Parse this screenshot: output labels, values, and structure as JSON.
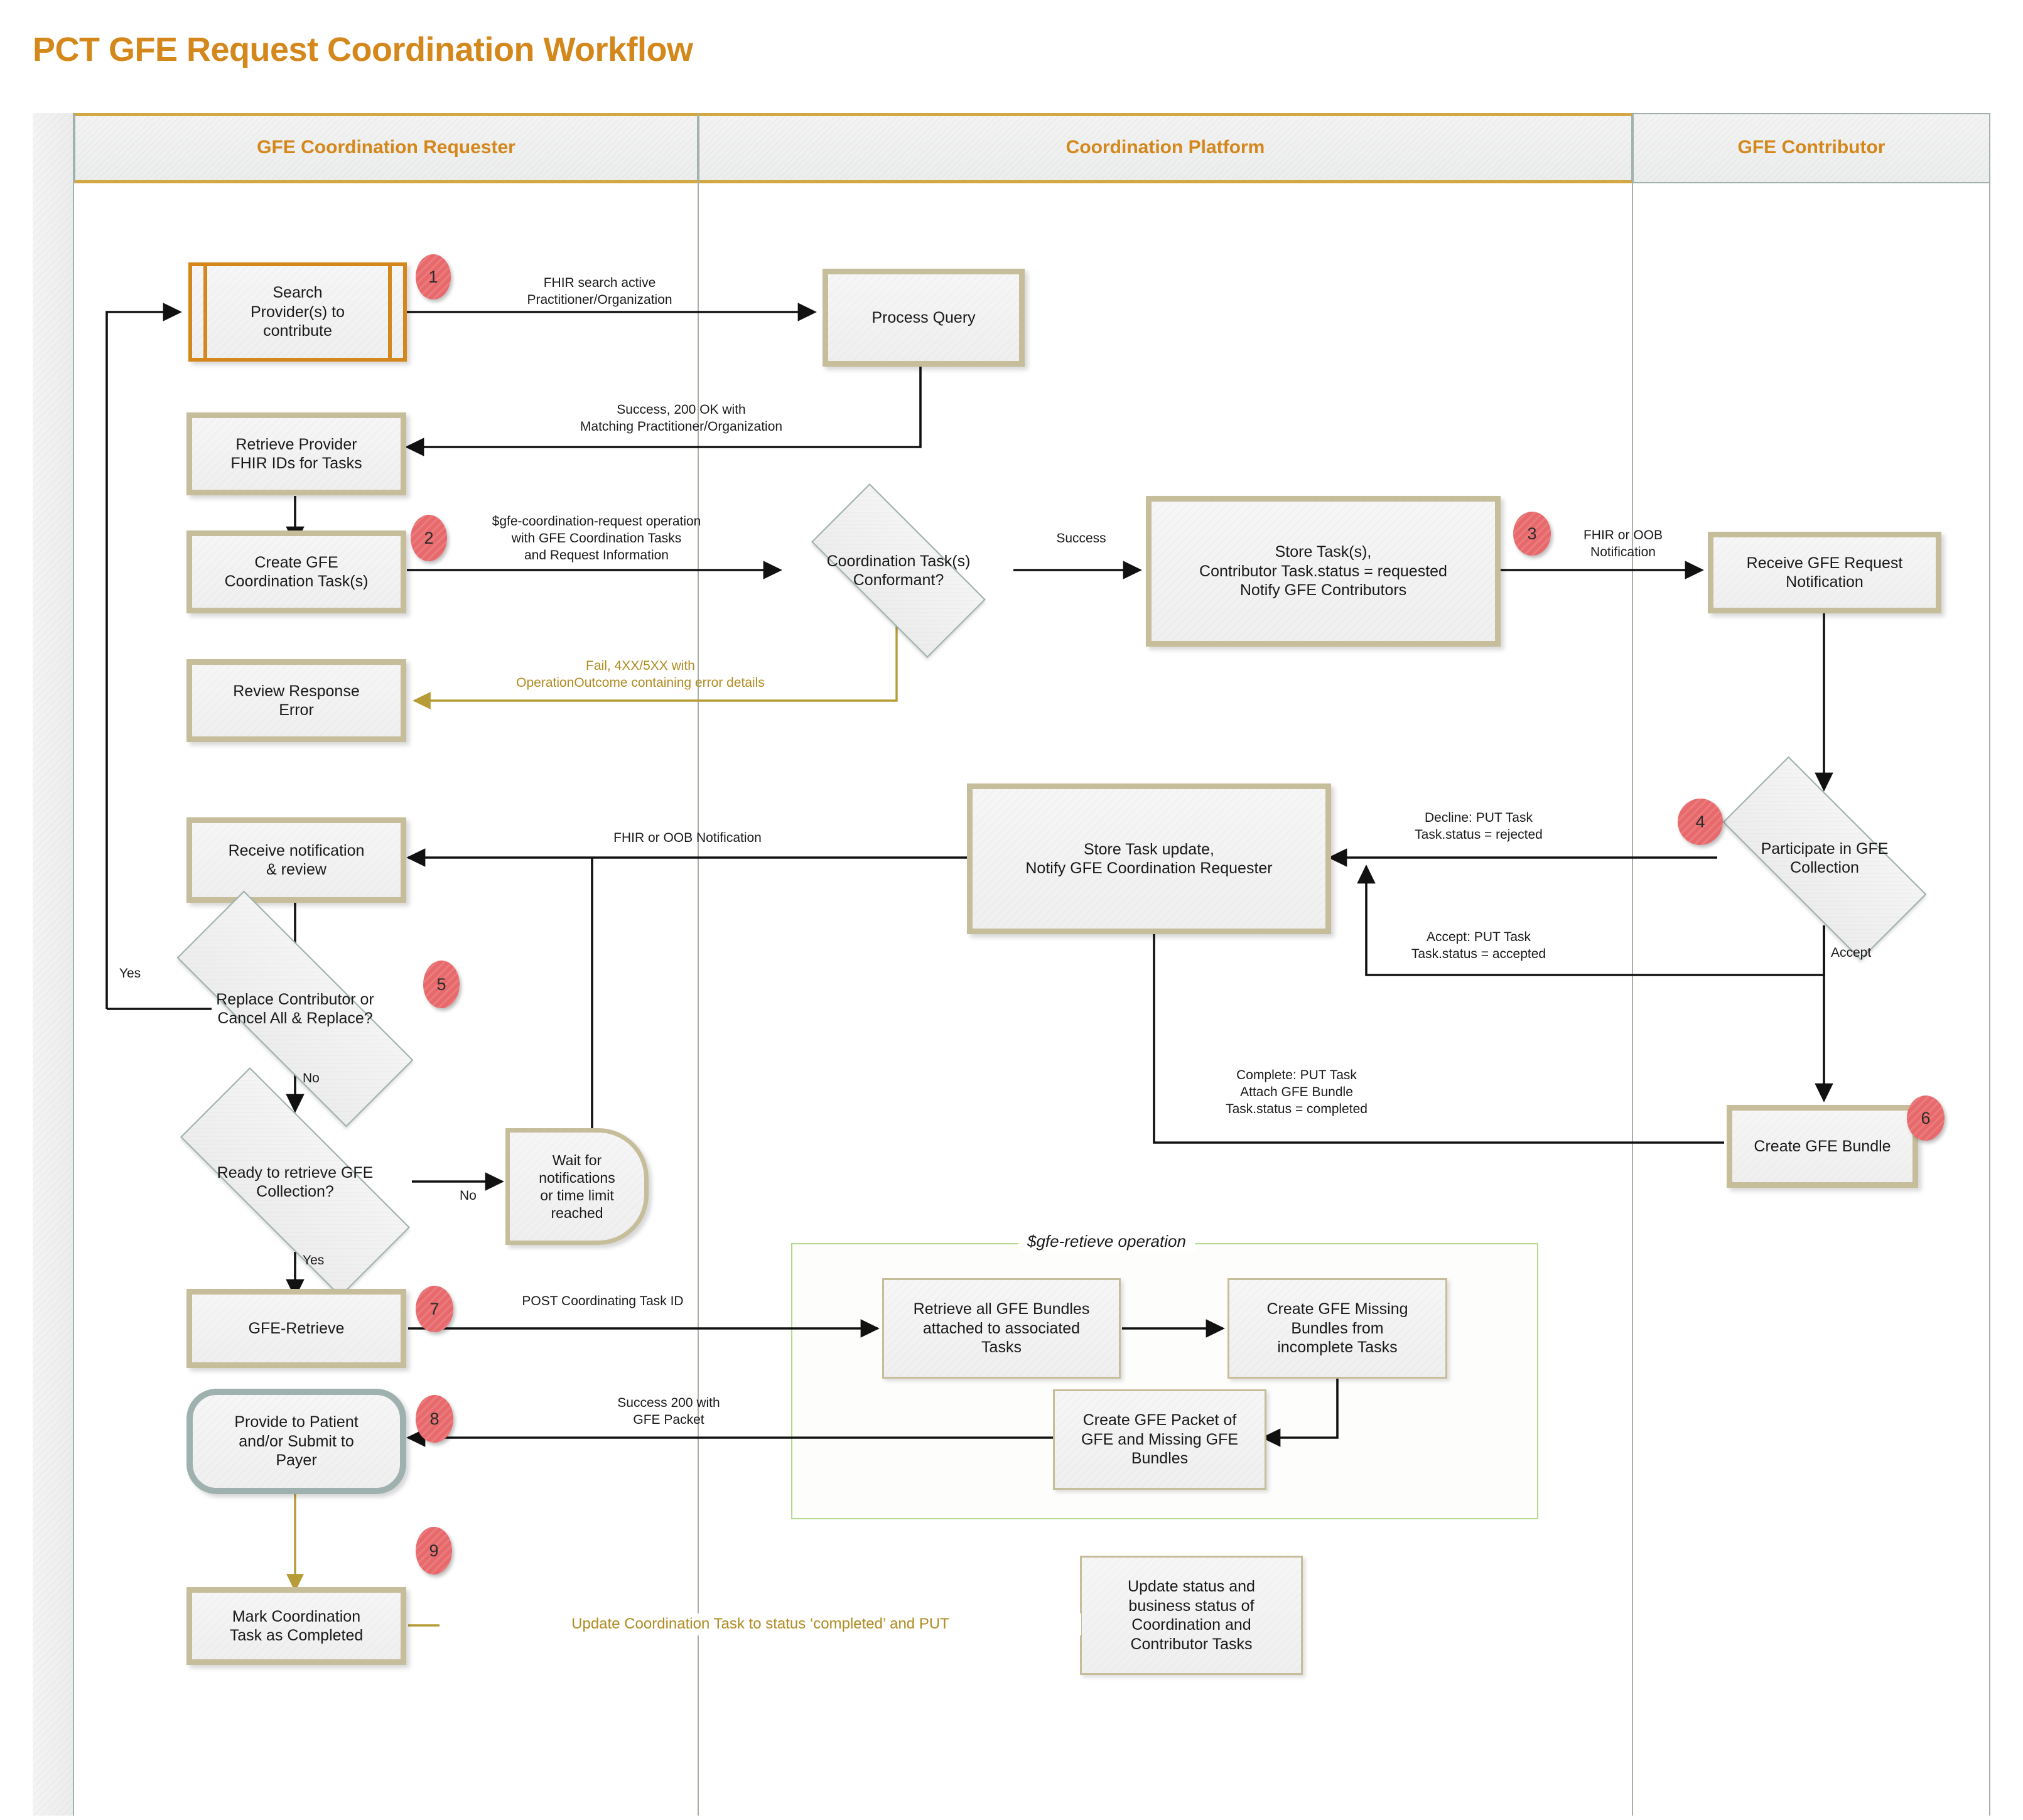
{
  "title": "PCT GFE Request Coordination Workflow",
  "lanes": [
    {
      "id": "requester",
      "label": "GFE Coordination Requester"
    },
    {
      "id": "platform",
      "label": "Coordination Platform"
    },
    {
      "id": "contributor",
      "label": "GFE Contributor"
    }
  ],
  "colors": {
    "accent_orange": "#D4871B",
    "lane_border": "#9FB1AF",
    "lane_active_bar": "#D3A843",
    "badge_red": "#E8696B",
    "node_border_tan": "#C6BD9A",
    "terminator_teal": "#9FB1AF",
    "group_green": "#B4D98C",
    "gold_edge": "#B08B21"
  },
  "nodes": {
    "search_providers": {
      "label": "Search\nProvider(s) to\ncontribute",
      "shape": "predefined-process",
      "lane": "requester"
    },
    "process_query": {
      "label": "Process Query",
      "shape": "process",
      "lane": "platform"
    },
    "retrieve_ids": {
      "label": "Retrieve Provider\nFHIR IDs for Tasks",
      "shape": "process",
      "lane": "requester"
    },
    "create_tasks": {
      "label": "Create GFE\nCoordination Task(s)",
      "shape": "process",
      "lane": "requester"
    },
    "conformant": {
      "label": "Coordination Task(s)\nConformant?",
      "shape": "decision",
      "lane": "platform"
    },
    "store_tasks": {
      "label": "Store Task(s),\nContributor Task.status = requested\nNotify GFE Contributors",
      "shape": "process",
      "lane": "platform"
    },
    "review_error": {
      "label": "Review Response\nError",
      "shape": "process",
      "lane": "requester"
    },
    "receive_req_notif": {
      "label": "Receive GFE Request\nNotification",
      "shape": "process",
      "lane": "contributor"
    },
    "store_task_update": {
      "label": "Store Task update,\nNotify GFE Coordination Requester",
      "shape": "process",
      "lane": "platform"
    },
    "participate": {
      "label": "Participate in GFE\nCollection",
      "shape": "decision",
      "lane": "contributor"
    },
    "receive_notif": {
      "label": "Receive notification\n& review",
      "shape": "process",
      "lane": "requester"
    },
    "replace_contrib": {
      "label": "Replace Contributor or\nCancel All & Replace?",
      "shape": "decision",
      "lane": "requester"
    },
    "ready_retrieve": {
      "label": "Ready to retrieve GFE\nCollection?",
      "shape": "decision",
      "lane": "requester"
    },
    "wait_notifs": {
      "label": "Wait for\nnotifications\nor time limit\nreached",
      "shape": "delay",
      "lane": "requester"
    },
    "create_bundle": {
      "label": "Create GFE Bundle",
      "shape": "process",
      "lane": "contributor"
    },
    "gfe_retrieve": {
      "label": "GFE-Retrieve",
      "shape": "process",
      "lane": "requester"
    },
    "retrieve_bundles": {
      "label": "Retrieve all GFE Bundles\nattached to associated\nTasks",
      "shape": "process-thin",
      "lane": "platform"
    },
    "create_missing": {
      "label": "Create GFE Missing\nBundles from\nincomplete Tasks",
      "shape": "process-thin",
      "lane": "platform"
    },
    "create_packet": {
      "label": "Create GFE Packet of\nGFE and Missing GFE\nBundles",
      "shape": "process-thin",
      "lane": "platform"
    },
    "provide_patient": {
      "label": "Provide to Patient\nand/or Submit to\nPayer",
      "shape": "terminator",
      "lane": "requester"
    },
    "mark_completed": {
      "label": "Mark Coordination\nTask as Completed",
      "shape": "process",
      "lane": "requester"
    },
    "update_status": {
      "label": "Update status and\nbusiness status of\nCoordination and\nContributor Tasks",
      "shape": "process-thin",
      "lane": "platform"
    }
  },
  "badges": [
    {
      "id": "b1",
      "number": "1",
      "for": "search_providers"
    },
    {
      "id": "b2",
      "number": "2",
      "for": "create_tasks"
    },
    {
      "id": "b3",
      "number": "3",
      "for": "store_tasks"
    },
    {
      "id": "b4",
      "number": "4",
      "for": "participate"
    },
    {
      "id": "b5",
      "number": "5",
      "for": "replace_contrib"
    },
    {
      "id": "b6",
      "number": "6",
      "for": "create_bundle"
    },
    {
      "id": "b7",
      "number": "7",
      "for": "gfe_retrieve"
    },
    {
      "id": "b8",
      "number": "8",
      "for": "provide_patient"
    },
    {
      "id": "b9",
      "number": "9",
      "for": "mark_completed"
    }
  ],
  "edge_labels": {
    "fhir_search": "FHIR search active\nPractitioner/Organization",
    "success_200": "Success, 200 OK with\nMatching Practitioner/Organization",
    "gfe_coord_request": "$gfe-coordination-request operation\nwith GFE Coordination Tasks\nand Request Information",
    "fail_4xx": "Fail, 4XX/5XX with\nOperationOutcome containing error details",
    "success": "Success",
    "fhir_oob_3": "FHIR or OOB\nNotification",
    "decline": "Decline: PUT Task\nTask.status = rejected",
    "accept_put": "Accept: PUT Task\nTask.status = accepted",
    "accept": "Accept",
    "fhir_oob_notif": "FHIR or OOB Notification",
    "yes_replace": "Yes",
    "no_replace": "No",
    "no_ready": "No",
    "yes_ready": "Yes",
    "complete_put": "Complete: PUT Task\nAttach GFE Bundle\nTask.status = completed",
    "post_task_id": "POST Coordinating Task ID",
    "success_packet": "Success 200 with\nGFE Packet",
    "update_coord_task": "Update Coordination Task to status ‘completed’ and PUT"
  },
  "groups": {
    "gfe_retrieve_op": {
      "label": "$gfe-retieve operation"
    }
  }
}
